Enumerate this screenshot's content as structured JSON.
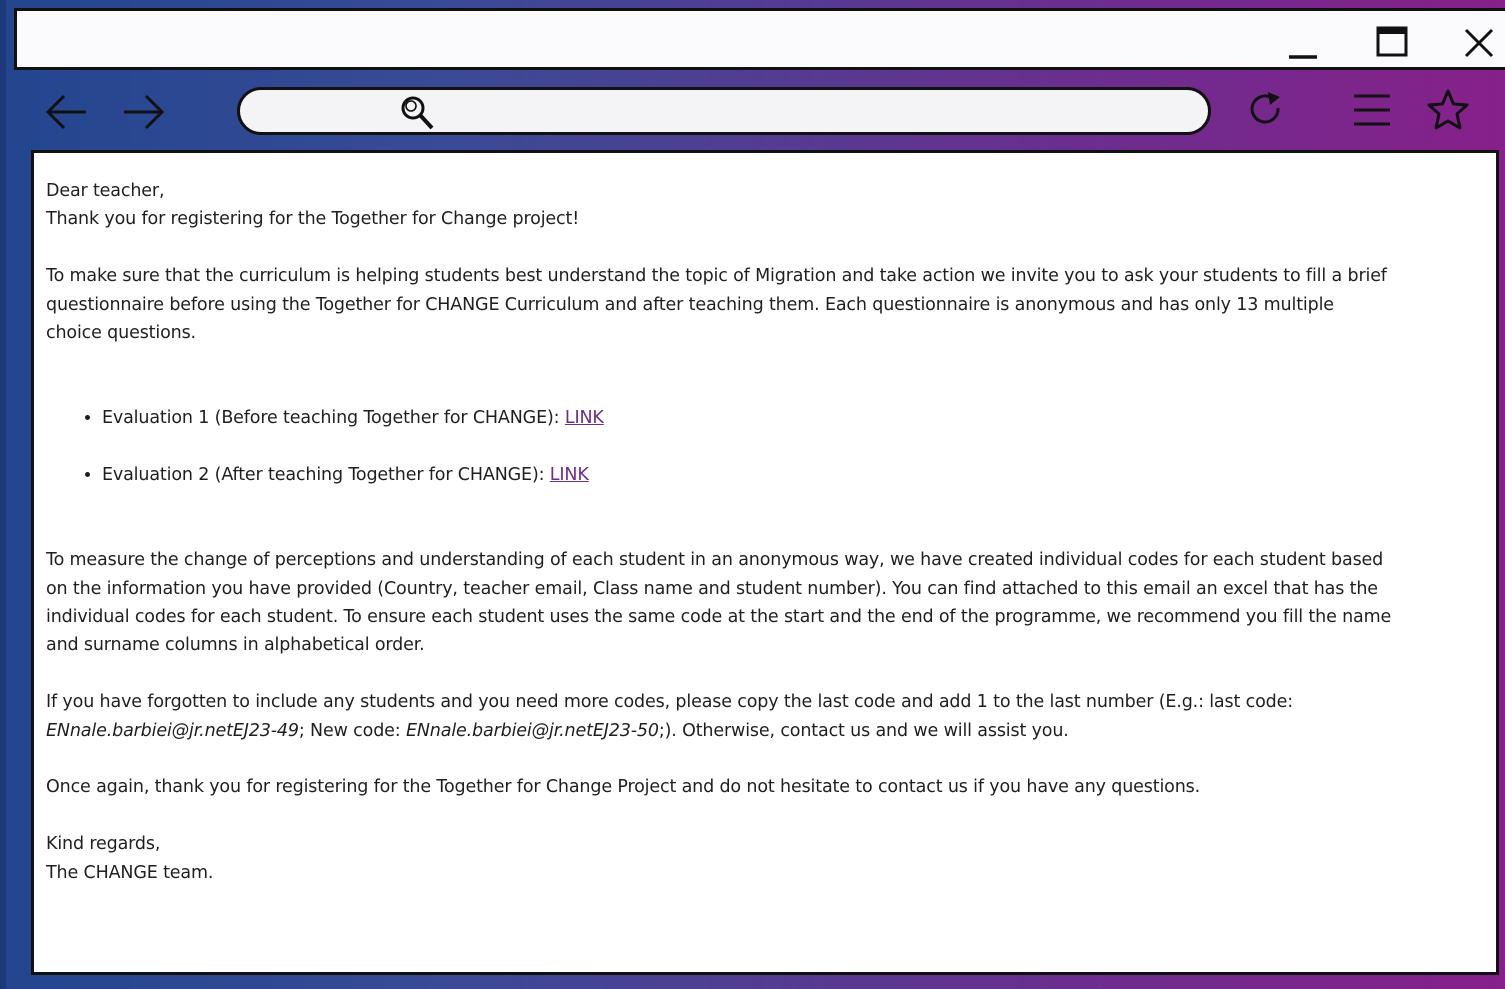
{
  "browser": {
    "address_placeholder": "",
    "icons": {
      "minimize": "minimize-icon",
      "maximize": "maximize-icon",
      "close": "close-icon",
      "back": "arrow-left-icon",
      "forward": "arrow-right-icon",
      "search": "search-icon",
      "reload": "reload-icon",
      "menu": "hamburger-menu-icon",
      "bookmark": "star-icon"
    },
    "colors": {
      "gradient_start": "#23468f",
      "gradient_end": "#86208a",
      "link": "#6b2d8e"
    }
  },
  "email": {
    "greeting": "Dear teacher,",
    "thanks": "Thank you for registering for the Together for Change project!",
    "intro_lines": [
      "To make sure that the curriculum is helping students best understand the topic of Migration and take action we invite you to ask your students to fill a brief",
      "questionnaire before using the Together for CHANGE Curriculum and after teaching them. Each questionnaire is anonymous and has only 13 multiple",
      "choice questions."
    ],
    "evaluations": [
      {
        "label": "Evaluation 1 (Before teaching Together for CHANGE): ",
        "link": "LINK"
      },
      {
        "label": "Evaluation 2 (After teaching Together for CHANGE): ",
        "link": "LINK"
      }
    ],
    "codes_lines": [
      "To measure the change of perceptions and understanding of each student in an anonymous way, we have created individual codes for each student based",
      "on the information you have provided (Country, teacher email, Class name and student number). You can find attached to this email an excel that has the",
      "individual codes for each student. To ensure each student uses the same code at the start and the end of the programme, we recommend you fill the name",
      "and surname columns in alphabetical order."
    ],
    "forgotten_line1": "If you have forgotten to include any students and you need more codes, please copy the last code and add 1 to the last number (E.g.: last code:",
    "example_last_code": "ENnale.barbiei@jr.netEJ23-49",
    "new_code_label": "; New code: ",
    "example_new_code": "ENnale.barbiei@jr.netEJ23-50",
    "forgotten_tail": ";). Otherwise, contact us and we will assist you.",
    "closing": "Once again, thank you for registering for the Together for Change Project and do not hesitate to contact us if you have any questions.",
    "signoff": "Kind regards,",
    "signature": "The CHANGE team."
  }
}
